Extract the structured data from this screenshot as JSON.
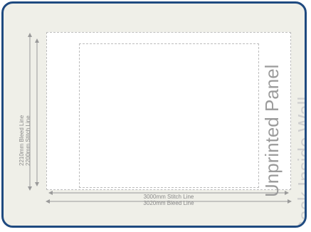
{
  "panel": {
    "center_label": "Unprinted Panel",
    "wall_label": "Back Inside Wall"
  },
  "dimensions": {
    "height_bleed": "2210mm Bleed Line",
    "height_stitch": "2200mm Stitch Line",
    "width_stitch": "3000mm Stitch Line",
    "width_bleed": "3020mm Bleed Line"
  },
  "colors": {
    "frame_border": "#1f4a80",
    "frame_fill": "#efefe8",
    "panel_fill": "#ffffff",
    "dashed_line": "#bdbdbd",
    "dimension_line": "#9a9a9a"
  }
}
